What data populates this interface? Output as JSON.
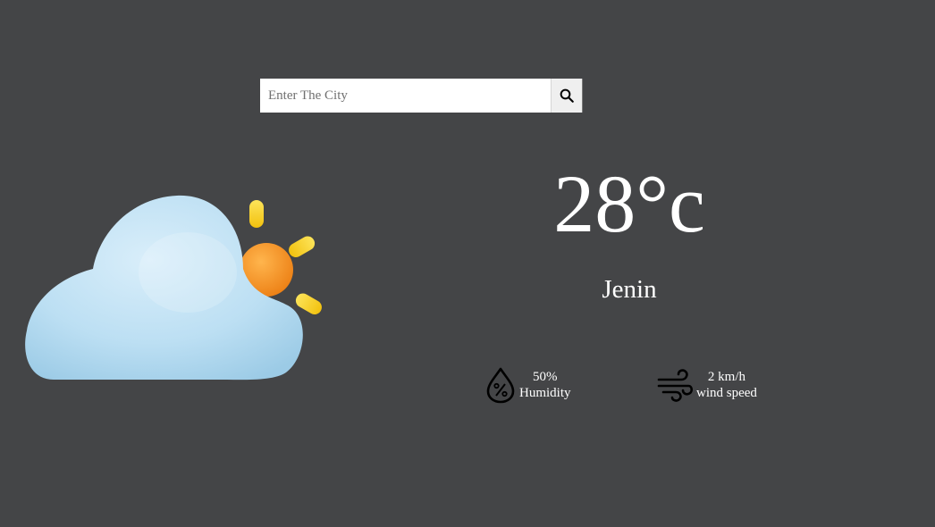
{
  "search": {
    "placeholder": "Enter The City",
    "value": ""
  },
  "icons": {
    "search_button": "search-icon",
    "weather": "partly-cloudy-icon",
    "humidity": "humidity-drop-icon",
    "wind": "wind-icon"
  },
  "weather": {
    "temperature": "28°c",
    "city": "Jenin"
  },
  "stats": {
    "humidity": {
      "value": "50%",
      "label": "Humidity"
    },
    "wind": {
      "value": "2 km/h",
      "label": "wind speed"
    }
  },
  "colors": {
    "background": "#444547",
    "text": "#ffffff",
    "cloud": "#bfe0f2",
    "sun": "#f5952a",
    "rays": "#f7d22a"
  }
}
